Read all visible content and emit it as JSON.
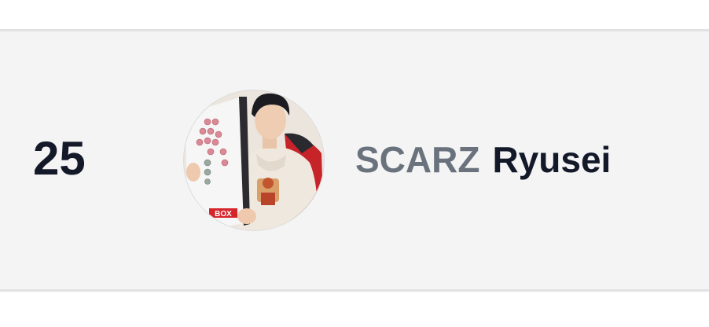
{
  "ranking_entry": {
    "rank": "25",
    "team": "SCARZ",
    "player": "Ryusei",
    "avatar_icon": "player-photo-avatar",
    "controller_logo_text": "BOX"
  },
  "colors": {
    "row_background": "#f4f4f4",
    "divider": "#e2e2e2",
    "rank_text": "#14192a",
    "team_text": "#6a737d",
    "player_text": "#14192a"
  }
}
